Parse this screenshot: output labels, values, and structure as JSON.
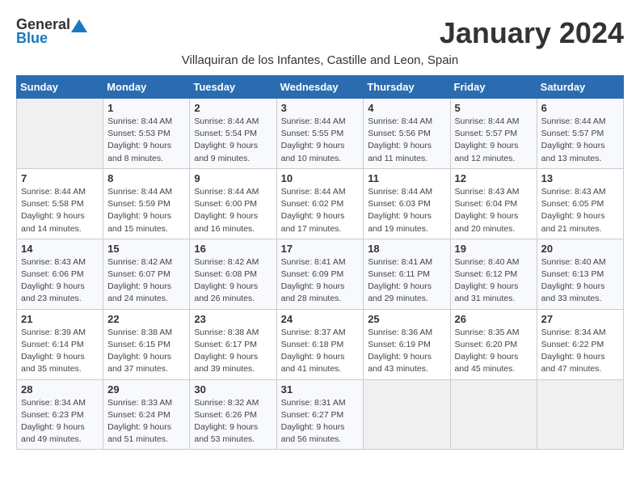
{
  "header": {
    "logo_general": "General",
    "logo_blue": "Blue",
    "month_title": "January 2024",
    "subtitle": "Villaquiran de los Infantes, Castille and Leon, Spain"
  },
  "days_of_week": [
    "Sunday",
    "Monday",
    "Tuesday",
    "Wednesday",
    "Thursday",
    "Friday",
    "Saturday"
  ],
  "weeks": [
    [
      {
        "day": "",
        "info": ""
      },
      {
        "day": "1",
        "info": "Sunrise: 8:44 AM\nSunset: 5:53 PM\nDaylight: 9 hours\nand 8 minutes."
      },
      {
        "day": "2",
        "info": "Sunrise: 8:44 AM\nSunset: 5:54 PM\nDaylight: 9 hours\nand 9 minutes."
      },
      {
        "day": "3",
        "info": "Sunrise: 8:44 AM\nSunset: 5:55 PM\nDaylight: 9 hours\nand 10 minutes."
      },
      {
        "day": "4",
        "info": "Sunrise: 8:44 AM\nSunset: 5:56 PM\nDaylight: 9 hours\nand 11 minutes."
      },
      {
        "day": "5",
        "info": "Sunrise: 8:44 AM\nSunset: 5:57 PM\nDaylight: 9 hours\nand 12 minutes."
      },
      {
        "day": "6",
        "info": "Sunrise: 8:44 AM\nSunset: 5:57 PM\nDaylight: 9 hours\nand 13 minutes."
      }
    ],
    [
      {
        "day": "7",
        "info": "Sunrise: 8:44 AM\nSunset: 5:58 PM\nDaylight: 9 hours\nand 14 minutes."
      },
      {
        "day": "8",
        "info": "Sunrise: 8:44 AM\nSunset: 5:59 PM\nDaylight: 9 hours\nand 15 minutes."
      },
      {
        "day": "9",
        "info": "Sunrise: 8:44 AM\nSunset: 6:00 PM\nDaylight: 9 hours\nand 16 minutes."
      },
      {
        "day": "10",
        "info": "Sunrise: 8:44 AM\nSunset: 6:02 PM\nDaylight: 9 hours\nand 17 minutes."
      },
      {
        "day": "11",
        "info": "Sunrise: 8:44 AM\nSunset: 6:03 PM\nDaylight: 9 hours\nand 19 minutes."
      },
      {
        "day": "12",
        "info": "Sunrise: 8:43 AM\nSunset: 6:04 PM\nDaylight: 9 hours\nand 20 minutes."
      },
      {
        "day": "13",
        "info": "Sunrise: 8:43 AM\nSunset: 6:05 PM\nDaylight: 9 hours\nand 21 minutes."
      }
    ],
    [
      {
        "day": "14",
        "info": "Sunrise: 8:43 AM\nSunset: 6:06 PM\nDaylight: 9 hours\nand 23 minutes."
      },
      {
        "day": "15",
        "info": "Sunrise: 8:42 AM\nSunset: 6:07 PM\nDaylight: 9 hours\nand 24 minutes."
      },
      {
        "day": "16",
        "info": "Sunrise: 8:42 AM\nSunset: 6:08 PM\nDaylight: 9 hours\nand 26 minutes."
      },
      {
        "day": "17",
        "info": "Sunrise: 8:41 AM\nSunset: 6:09 PM\nDaylight: 9 hours\nand 28 minutes."
      },
      {
        "day": "18",
        "info": "Sunrise: 8:41 AM\nSunset: 6:11 PM\nDaylight: 9 hours\nand 29 minutes."
      },
      {
        "day": "19",
        "info": "Sunrise: 8:40 AM\nSunset: 6:12 PM\nDaylight: 9 hours\nand 31 minutes."
      },
      {
        "day": "20",
        "info": "Sunrise: 8:40 AM\nSunset: 6:13 PM\nDaylight: 9 hours\nand 33 minutes."
      }
    ],
    [
      {
        "day": "21",
        "info": "Sunrise: 8:39 AM\nSunset: 6:14 PM\nDaylight: 9 hours\nand 35 minutes."
      },
      {
        "day": "22",
        "info": "Sunrise: 8:38 AM\nSunset: 6:15 PM\nDaylight: 9 hours\nand 37 minutes."
      },
      {
        "day": "23",
        "info": "Sunrise: 8:38 AM\nSunset: 6:17 PM\nDaylight: 9 hours\nand 39 minutes."
      },
      {
        "day": "24",
        "info": "Sunrise: 8:37 AM\nSunset: 6:18 PM\nDaylight: 9 hours\nand 41 minutes."
      },
      {
        "day": "25",
        "info": "Sunrise: 8:36 AM\nSunset: 6:19 PM\nDaylight: 9 hours\nand 43 minutes."
      },
      {
        "day": "26",
        "info": "Sunrise: 8:35 AM\nSunset: 6:20 PM\nDaylight: 9 hours\nand 45 minutes."
      },
      {
        "day": "27",
        "info": "Sunrise: 8:34 AM\nSunset: 6:22 PM\nDaylight: 9 hours\nand 47 minutes."
      }
    ],
    [
      {
        "day": "28",
        "info": "Sunrise: 8:34 AM\nSunset: 6:23 PM\nDaylight: 9 hours\nand 49 minutes."
      },
      {
        "day": "29",
        "info": "Sunrise: 8:33 AM\nSunset: 6:24 PM\nDaylight: 9 hours\nand 51 minutes."
      },
      {
        "day": "30",
        "info": "Sunrise: 8:32 AM\nSunset: 6:26 PM\nDaylight: 9 hours\nand 53 minutes."
      },
      {
        "day": "31",
        "info": "Sunrise: 8:31 AM\nSunset: 6:27 PM\nDaylight: 9 hours\nand 56 minutes."
      },
      {
        "day": "",
        "info": ""
      },
      {
        "day": "",
        "info": ""
      },
      {
        "day": "",
        "info": ""
      }
    ]
  ]
}
